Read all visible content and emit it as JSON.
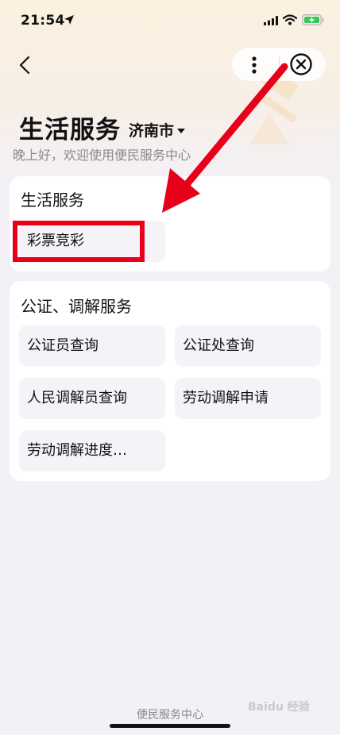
{
  "status_bar": {
    "time": "21:54"
  },
  "header": {
    "title": "生活服务",
    "city": "济南市",
    "greeting": "晚上好，欢迎使用便民服务中心"
  },
  "sections": [
    {
      "title": "生活服务",
      "items": [
        "彩票竞彩"
      ]
    },
    {
      "title": "公证、调解服务",
      "items": [
        "公证员查询",
        "公证处查询",
        "人民调解员查询",
        "劳动调解申请",
        "劳动调解进度…"
      ]
    }
  ],
  "footer": {
    "label": "便民服务中心"
  },
  "watermark": "Baidu 经验",
  "colors": {
    "annotation_red": "#e8001a",
    "background": "#f3f0f6",
    "card": "#ffffff",
    "item": "#f6f3f8"
  }
}
